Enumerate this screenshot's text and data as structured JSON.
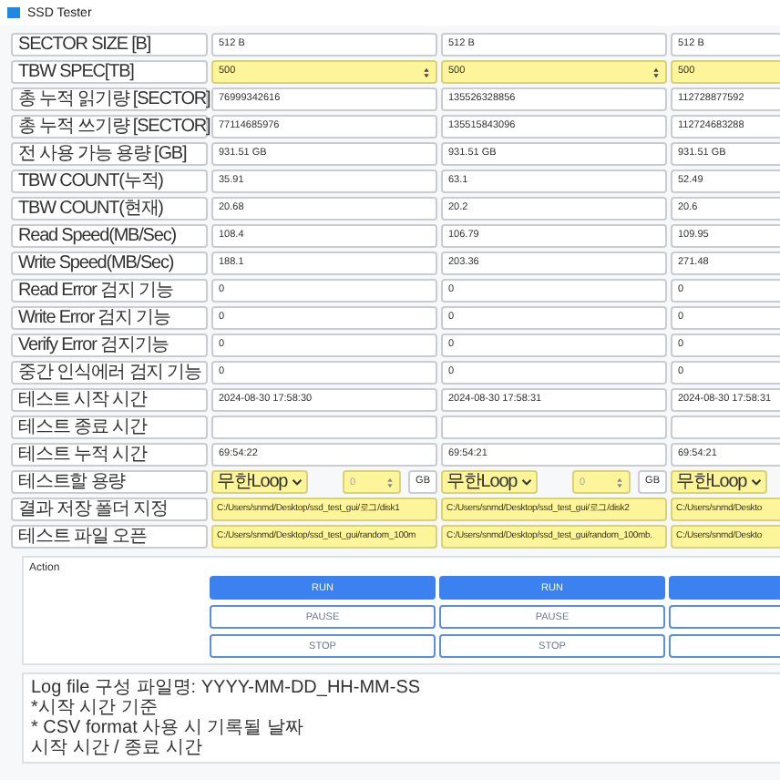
{
  "window": {
    "title": "SSD Tester"
  },
  "rows": [
    {
      "label": "SECTOR SIZE [B]",
      "kind": "text",
      "cells": [
        {
          "value": "512 B"
        },
        {
          "value": "512 B"
        },
        {
          "value": "512 B"
        }
      ]
    },
    {
      "label": "TBW SPEC[TB]",
      "kind": "spin",
      "cells": [
        {
          "value": "500"
        },
        {
          "value": "500"
        },
        {
          "value": "500"
        }
      ]
    },
    {
      "label": "총 누적 읽기량 [SECTOR]",
      "kind": "text",
      "cells": [
        {
          "value": "76999342616"
        },
        {
          "value": "135526328856"
        },
        {
          "value": "112728877592"
        }
      ]
    },
    {
      "label": "총 누적 쓰기량 [SECTOR]",
      "kind": "text",
      "cells": [
        {
          "value": "77114685976"
        },
        {
          "value": "135515843096"
        },
        {
          "value": "112724683288"
        }
      ]
    },
    {
      "label": "전 사용 가능 용량 [GB]",
      "kind": "text",
      "cells": [
        {
          "value": "931.51 GB"
        },
        {
          "value": "931.51 GB"
        },
        {
          "value": "931.51 GB"
        }
      ]
    },
    {
      "label": "TBW COUNT(누적)",
      "kind": "text",
      "cells": [
        {
          "value": "35.91"
        },
        {
          "value": "63.1"
        },
        {
          "value": "52.49"
        }
      ]
    },
    {
      "label": "TBW COUNT(현재)",
      "kind": "text",
      "cells": [
        {
          "value": "20.68"
        },
        {
          "value": "20.2"
        },
        {
          "value": "20.6"
        }
      ]
    },
    {
      "label": "Read Speed(MB/Sec)",
      "kind": "text",
      "cells": [
        {
          "value": "108.4"
        },
        {
          "value": "106.79"
        },
        {
          "value": "109.95"
        }
      ]
    },
    {
      "label": "Write Speed(MB/Sec)",
      "kind": "text",
      "cells": [
        {
          "value": "188.1"
        },
        {
          "value": "203.36"
        },
        {
          "value": "271.48"
        }
      ]
    },
    {
      "label": "Read Error 검지 기능",
      "kind": "text",
      "cells": [
        {
          "value": "0"
        },
        {
          "value": "0"
        },
        {
          "value": "0"
        }
      ]
    },
    {
      "label": "Write Error 검지 기능",
      "kind": "text",
      "cells": [
        {
          "value": "0"
        },
        {
          "value": "0"
        },
        {
          "value": "0"
        }
      ]
    },
    {
      "label": "Verify Error 검지기능",
      "kind": "text",
      "cells": [
        {
          "value": "0"
        },
        {
          "value": "0"
        },
        {
          "value": "0"
        }
      ]
    },
    {
      "label": "중간 인식에러 검지 기능",
      "kind": "text",
      "cells": [
        {
          "value": "0"
        },
        {
          "value": "0"
        },
        {
          "value": "0"
        }
      ]
    },
    {
      "label": "테스트 시작 시간",
      "kind": "text",
      "cells": [
        {
          "value": "2024-08-30 17:58:30"
        },
        {
          "value": "2024-08-30 17:58:31"
        },
        {
          "value": "2024-08-30 17:58:31"
        }
      ]
    },
    {
      "label": "테스트 종료 시간",
      "kind": "text",
      "cells": [
        {},
        {},
        {}
      ]
    },
    {
      "label": "테스트 누적 시간",
      "kind": "text",
      "cells": [
        {
          "value": "69:54:22"
        },
        {
          "value": "69:54:21"
        },
        {
          "value": "69:54:21"
        }
      ]
    },
    {
      "label": "테스트할 용량",
      "kind": "capacity",
      "cells": [
        {
          "mode": "무한Loop",
          "amount": "0",
          "unit": "GB"
        },
        {
          "mode": "무한Loop",
          "amount": "0",
          "unit": "GB"
        },
        {
          "mode": "무한Loop"
        }
      ]
    },
    {
      "label": "결과 저장 폴더 지정",
      "kind": "path",
      "cells": [
        {
          "value": "C:/Users/snmd/Desktop/ssd_test_gui/로그/disk1"
        },
        {
          "value": "C:/Users/snmd/Desktop/ssd_test_gui/로그/disk2"
        },
        {
          "value": "C:/Users/snmd/Deskto"
        }
      ]
    },
    {
      "label": "테스트 파일 오픈",
      "kind": "path",
      "cells": [
        {
          "value": "C:/Users/snmd/Desktop/ssd_test_gui/random_100m"
        },
        {
          "value": "C:/Users/snmd/Desktop/ssd_test_gui/random_100mb."
        },
        {
          "value": "C:/Users/snmd/Deskto"
        }
      ]
    }
  ],
  "action": {
    "title": "Action",
    "columns": [
      {
        "buttons": [
          {
            "kind": "run",
            "label": "RUN"
          },
          {
            "kind": "pause",
            "label": "PAUSE"
          },
          {
            "kind": "stop",
            "label": "STOP"
          }
        ]
      },
      {
        "buttons": [
          {
            "kind": "run",
            "label": "RUN"
          },
          {
            "kind": "pause",
            "label": "PAUSE"
          },
          {
            "kind": "stop",
            "label": "STOP"
          }
        ]
      },
      {
        "buttons": [
          {
            "kind": "run"
          },
          {
            "kind": "pause"
          },
          {
            "kind": "stop"
          }
        ]
      }
    ]
  },
  "log": {
    "lines": [
      "Log file 구성 파일명: YYYY-MM-DD_HH-MM-SS",
      "*시작 시간 기준",
      "* CSV format 사용 시 기록될 날짜",
      "시작 시간 / 종료 시간"
    ]
  }
}
